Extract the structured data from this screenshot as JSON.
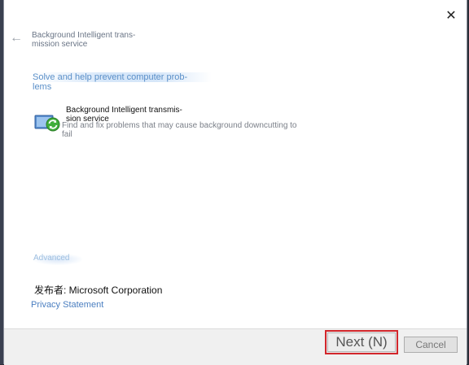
{
  "header": {
    "close_glyph": "✕",
    "back_glyph": "←",
    "title_line1": "Background Intelligent trans-",
    "title_line2": "mission service"
  },
  "section": {
    "heading_line1": "Solve and help prevent computer prob-",
    "heading_line2": "lems"
  },
  "item": {
    "icon": "troubleshooter-refresh-icon",
    "title_line1": "Background Intelligent transmis-",
    "title_line2": "sion service",
    "desc_line1": "Find and fix problems that may cause background downcutting to",
    "desc_line2": "fail"
  },
  "advanced": {
    "label": "Advanced"
  },
  "publisher": {
    "text": "发布者: Microsoft Corporation"
  },
  "privacy": {
    "label": "Privacy Statement"
  },
  "footer": {
    "next_label": "Next (N)",
    "cancel_label": "Cancel"
  },
  "colors": {
    "accent_link": "#4a7ec0",
    "highlight_border": "#d2262b"
  }
}
